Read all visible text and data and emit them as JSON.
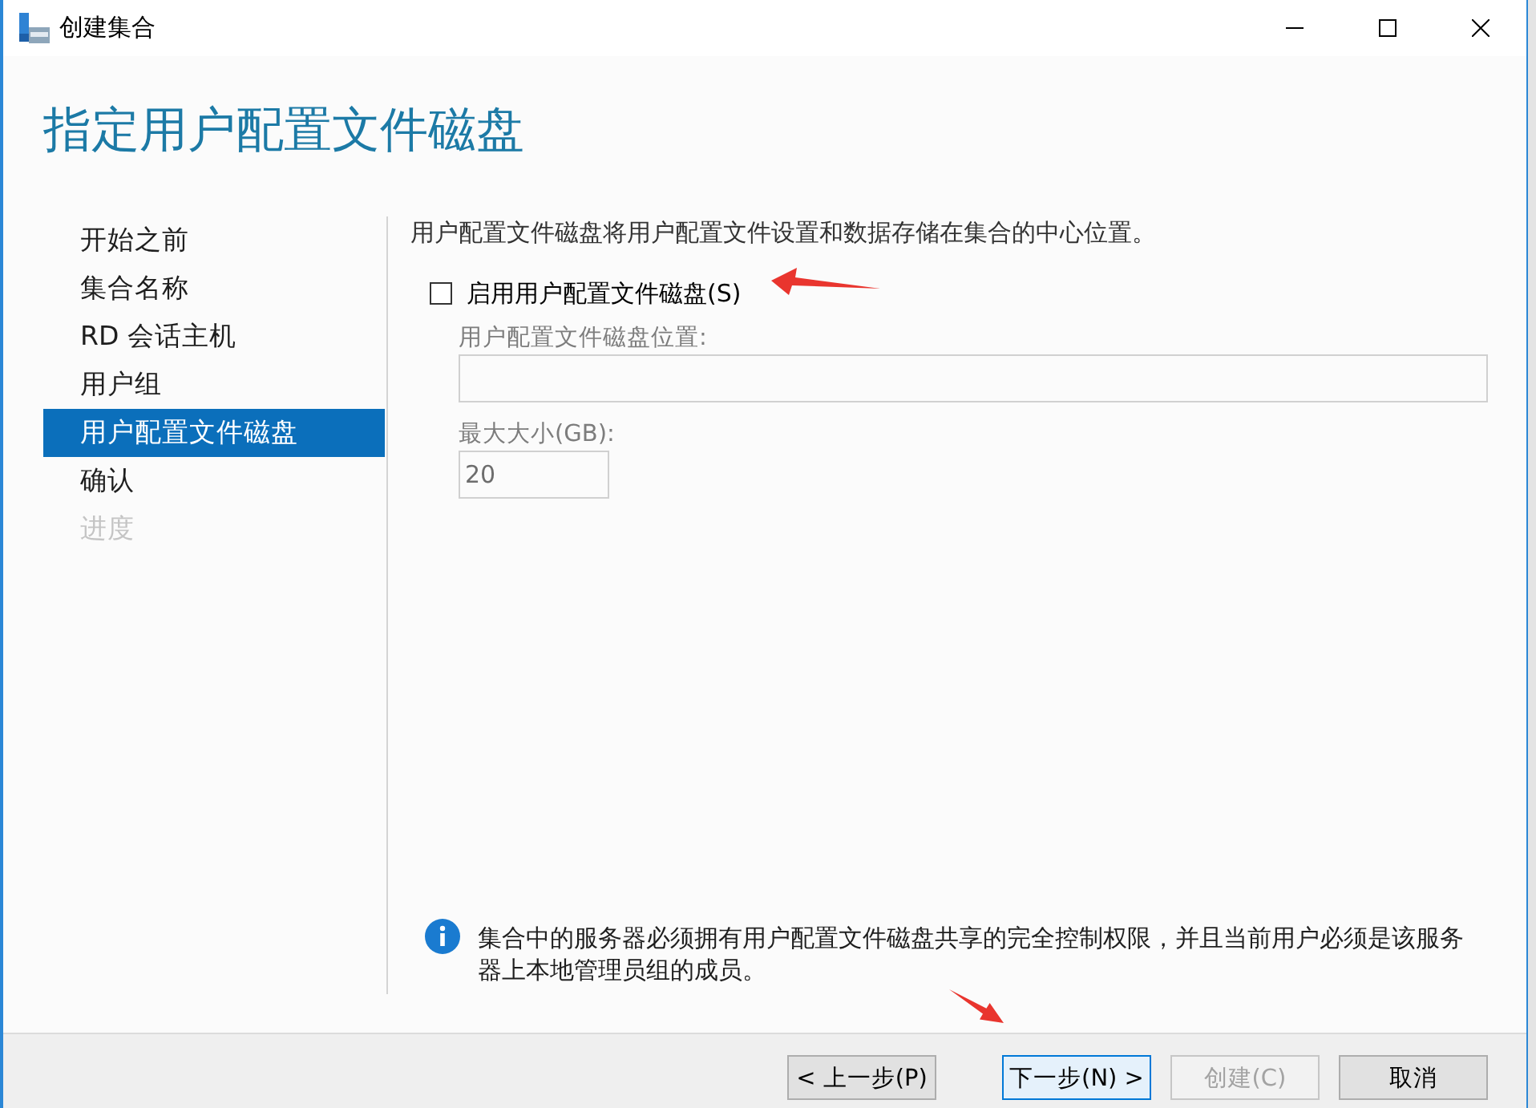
{
  "window": {
    "title": "创建集合"
  },
  "page_title": "指定用户配置文件磁盘",
  "steps": [
    {
      "label": "开始之前",
      "selected": false,
      "disabled": false
    },
    {
      "label": "集合名称",
      "selected": false,
      "disabled": false
    },
    {
      "label": "RD 会话主机",
      "selected": false,
      "disabled": false
    },
    {
      "label": "用户组",
      "selected": false,
      "disabled": false
    },
    {
      "label": "用户配置文件磁盘",
      "selected": true,
      "disabled": false
    },
    {
      "label": "确认",
      "selected": false,
      "disabled": false
    },
    {
      "label": "进度",
      "selected": false,
      "disabled": true
    }
  ],
  "description": "用户配置文件磁盘将用户配置文件设置和数据存储在集合的中心位置。",
  "enable_checkbox": {
    "label": "启用用户配置文件磁盘(S)",
    "checked": false
  },
  "fields": [
    {
      "kind": "text",
      "label": "用户配置文件磁盘位置:",
      "disabled": true
    },
    {
      "kind": "number",
      "label": "最大大小(GB):",
      "value": "20",
      "disabled": true
    }
  ],
  "info": {
    "text": "集合中的服务器必须拥有用户配置文件磁盘共享的完全控制权限，并且当前用户必须是该服务器上本地管理员组的成员。"
  },
  "buttons": [
    {
      "label": "< 上一步(P)",
      "disabled": false,
      "focused": false
    },
    {
      "label": "下一步(N) >",
      "disabled": false,
      "focused": true
    },
    {
      "label": "创建(C)",
      "disabled": true,
      "focused": false
    },
    {
      "label": "取消",
      "disabled": false,
      "focused": false
    }
  ]
}
